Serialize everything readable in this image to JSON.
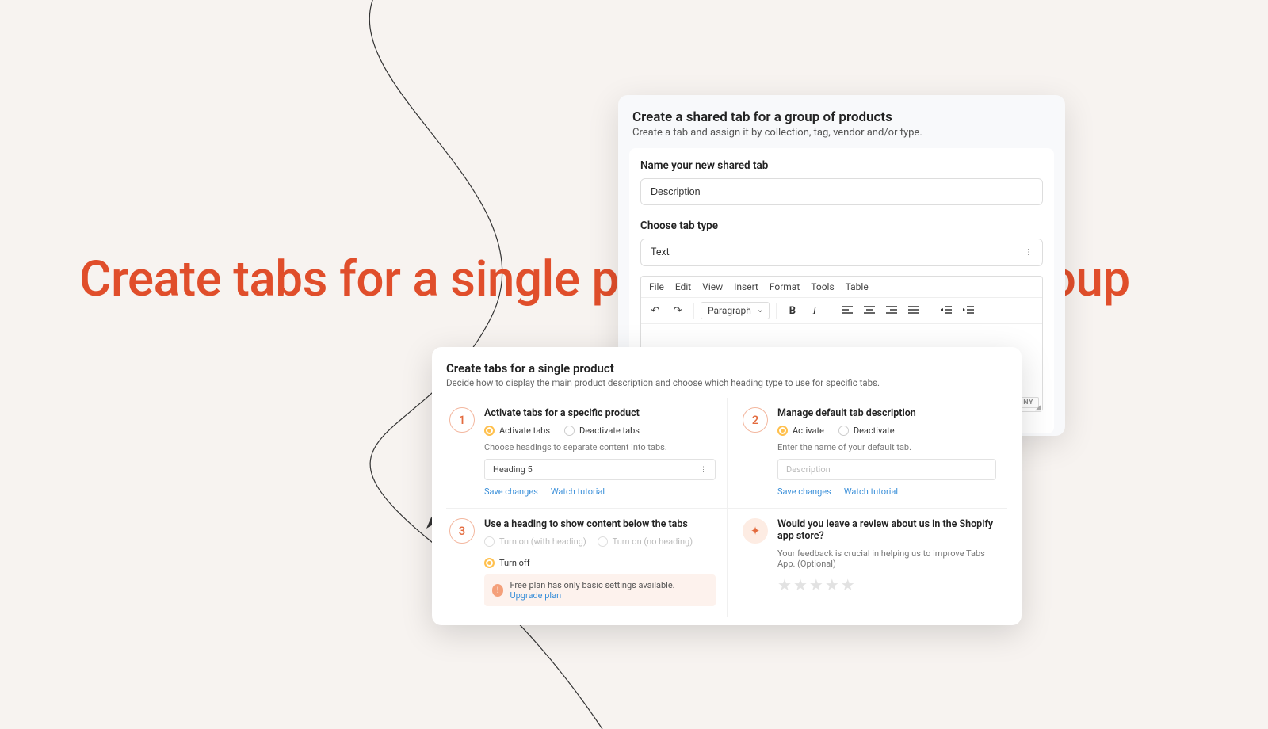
{
  "hero": "Create tabs for a single product or product group",
  "shared": {
    "title": "Create a shared tab for a group of products",
    "subtitle": "Create a tab and assign it by collection, tag, vendor and/or type.",
    "name_label": "Name your new shared tab",
    "name_value": "Description",
    "type_label": "Choose tab type",
    "type_value": "Text",
    "editor": {
      "menu": [
        "File",
        "Edit",
        "View",
        "Insert",
        "Format",
        "Tools",
        "Table"
      ],
      "block_style": "Paragraph",
      "brand": "TINY"
    }
  },
  "single": {
    "title": "Create tabs for a single product",
    "subtitle": "Decide how to display the main product description and choose which heading type to use for specific tabs.",
    "step1": {
      "num": "1",
      "title": "Activate tabs for a specific product",
      "opt_a": "Activate tabs",
      "opt_b": "Deactivate tabs",
      "helper": "Choose headings to separate content into tabs.",
      "select_value": "Heading 5",
      "save": "Save changes",
      "watch": "Watch tutorial"
    },
    "step2": {
      "num": "2",
      "title": "Manage default tab description",
      "opt_a": "Activate",
      "opt_b": "Deactivate",
      "helper": "Enter the name of your default tab.",
      "placeholder": "Description",
      "save": "Save changes",
      "watch": "Watch tutorial"
    },
    "step3": {
      "num": "3",
      "title": "Use a heading to show content below the tabs",
      "opt_a": "Turn on (with heading)",
      "opt_b": "Turn on (no heading)",
      "opt_c": "Turn off",
      "upgrade_text": "Free plan has only basic settings available.",
      "upgrade_link": "Upgrade plan"
    },
    "review": {
      "title": "Would you leave a review about us in the Shopify app store?",
      "sub": "Your feedback is crucial in helping us to improve Tabs App. (Optional)"
    }
  }
}
